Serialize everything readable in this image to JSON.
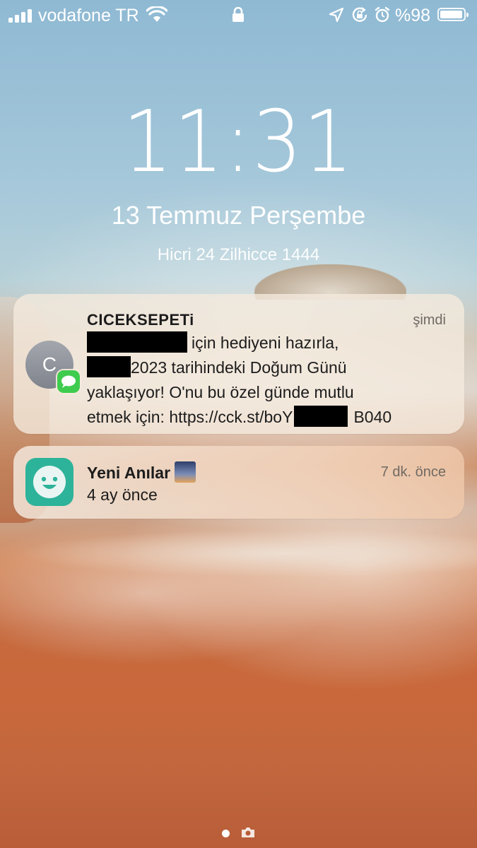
{
  "status_bar": {
    "carrier": "vodafone TR",
    "battery_percent": "%98",
    "battery_level": 0.98,
    "icons": [
      "signal-icon",
      "wifi-icon",
      "lock-icon",
      "location-icon",
      "rotation-lock-icon",
      "alarm-icon",
      "battery-icon"
    ]
  },
  "lock_screen": {
    "time": "11:31",
    "date": "13 Temmuz Perşembe",
    "hijri_date": "Hicri 24 Zilhicce 1444"
  },
  "notifications": [
    {
      "app": "Messages",
      "avatar_letter": "C",
      "sender": "CICEKSEPETi",
      "time": "şimdi",
      "line1": "için hediyeni hazırla,",
      "line2": "2023 tarihindeki Doğum Günü",
      "line3": "yaklaşıyor! O'nu bu özel günde mutlu",
      "line4_start": "etmek için: https://cck.st/boY",
      "line4_end": "B040"
    },
    {
      "app": "Photos Memories",
      "title": "Yeni Anılar",
      "body": "4 ay önce",
      "time": "7 dk. önce"
    }
  ],
  "colors": {
    "card_bg": "#f5ebde",
    "messages_green": "#3fcc4e",
    "app_icon_teal": "#2db39a"
  }
}
